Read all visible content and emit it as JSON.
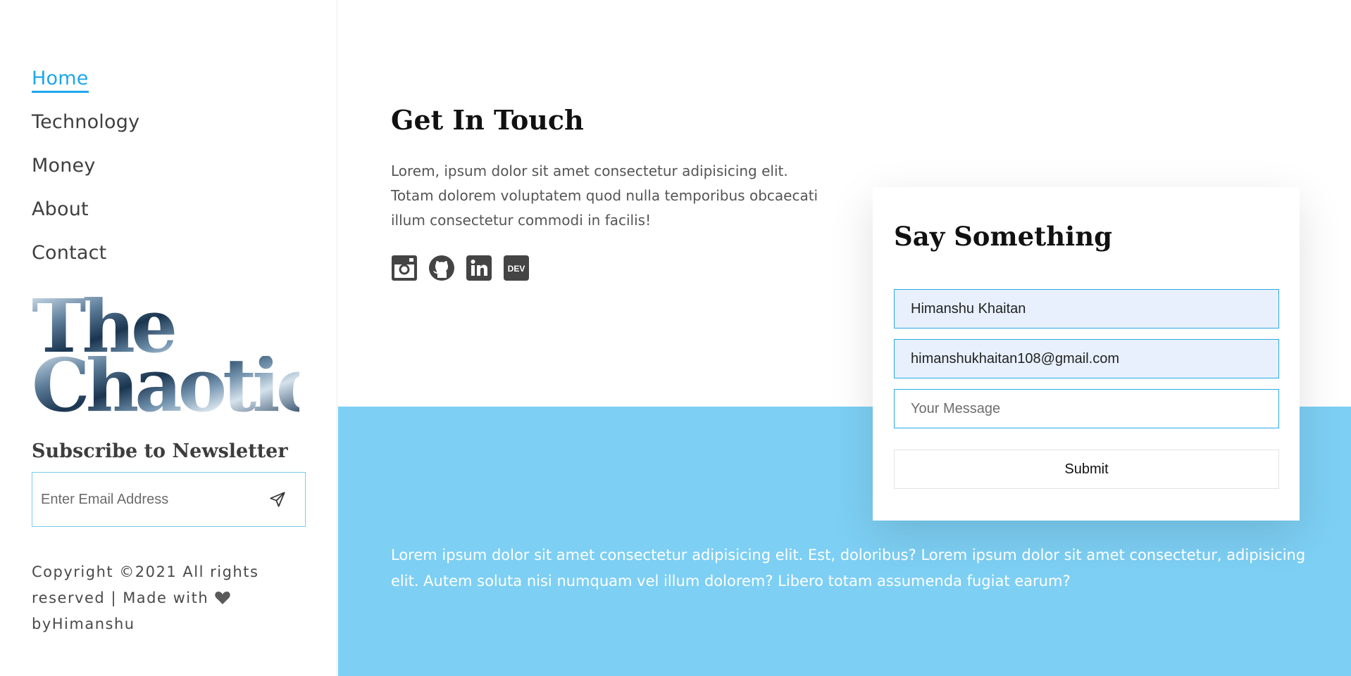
{
  "sidebar": {
    "nav": [
      {
        "label": "Home",
        "active": true
      },
      {
        "label": "Technology",
        "active": false
      },
      {
        "label": "Money",
        "active": false
      },
      {
        "label": "About",
        "active": false
      },
      {
        "label": "Contact",
        "active": false
      }
    ],
    "logo": {
      "line1": "The",
      "line2": "Chaotic"
    },
    "newsletter": {
      "title": "Subscribe to Newsletter",
      "placeholder": "Enter Email Address",
      "send_icon": "send-icon"
    },
    "copyright": {
      "prefix": "Copyright ©2021 All rights reserved | Made with",
      "suffix": "byHimanshu",
      "heart_icon": "heart-icon"
    }
  },
  "contact": {
    "title": "Get In Touch",
    "description": "Lorem, ipsum dolor sit amet consectetur adipisicing elit. Totam dolorem voluptatem quod nulla temporibus obcaecati illum consectetur commodi in facilis!",
    "socials": [
      "instagram-icon",
      "github-icon",
      "linkedin-icon",
      "dev-icon"
    ]
  },
  "form": {
    "title": "Say Something",
    "name_value": "Himanshu Khaitan",
    "email_value": "himanshukhaitan108@gmail.com",
    "message_placeholder": "Your Message",
    "submit_label": "Submit"
  },
  "band_text": "Lorem ipsum dolor sit amet consectetur adipisicing elit. Est, doloribus? Lorem ipsum dolor sit amet consectetur, adipisicing elit. Autem soluta nisi numquam vel illum dolorem? Libero totam assumenda fugiat earum?",
  "colors": {
    "accent": "#1ea7ec",
    "band": "#7dcff4",
    "input_border": "#29a9e1",
    "autofill": "#e8f0fe"
  }
}
